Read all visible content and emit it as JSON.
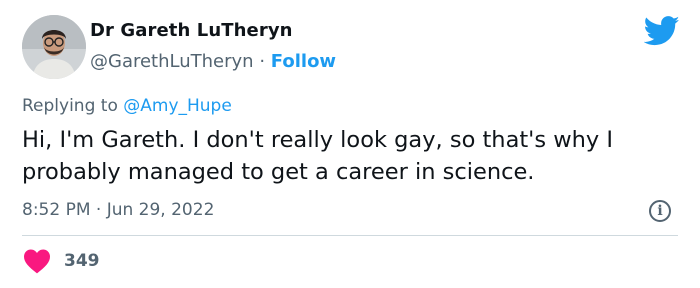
{
  "author": {
    "name": "Dr Gareth LuTheryn",
    "handle": "@GarethLuTheryn",
    "separator": "·",
    "follow_label": "Follow"
  },
  "reply": {
    "prefix": "Replying to",
    "mention": "@Amy_Hupe"
  },
  "tweet": {
    "text": "Hi, I'm Gareth. I don't really look gay, so that's why I probably managed to get a career in science.",
    "timestamp": "8:52 PM · Jun 29, 2022"
  },
  "engagement": {
    "likes": "349"
  },
  "icons": {
    "logo": "twitter-bird-icon",
    "info": "info-icon",
    "like": "heart-icon"
  },
  "colors": {
    "brand": "#1d9bf0",
    "like": "#f91880",
    "secondary_text": "#536471"
  }
}
